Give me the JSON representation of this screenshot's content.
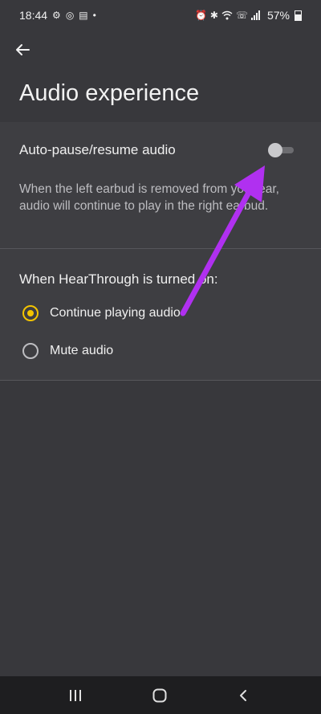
{
  "status_bar": {
    "time": "18:44",
    "battery": "57%",
    "left_icons": [
      "settings-notification-icon",
      "instagram-icon",
      "calendar-icon",
      "dot-icon"
    ],
    "right_icons": [
      "alarm-icon",
      "bluetooth-icon",
      "wifi-icon",
      "volte-call-icon",
      "signal-icon",
      "battery-icon"
    ]
  },
  "header": {
    "back_icon": "arrow-left-icon",
    "title": "Audio experience"
  },
  "auto_pause": {
    "label": "Auto-pause/resume audio",
    "enabled": false,
    "description": "When the left earbud is removed from your ear, audio will continue to play in the right earbud."
  },
  "hearthrough": {
    "label": "When HearThrough is turned on:",
    "options": [
      {
        "label": "Continue playing audio",
        "selected": true
      },
      {
        "label": "Mute audio",
        "selected": false
      }
    ]
  },
  "annotation": {
    "type": "arrow",
    "color": "#b030f0"
  },
  "colors": {
    "background": "#38383c",
    "accent": "#f4c400",
    "navbar": "#1e1e20"
  },
  "nav_bar": {
    "icons": [
      "recent-apps-icon",
      "home-icon",
      "back-icon"
    ]
  }
}
